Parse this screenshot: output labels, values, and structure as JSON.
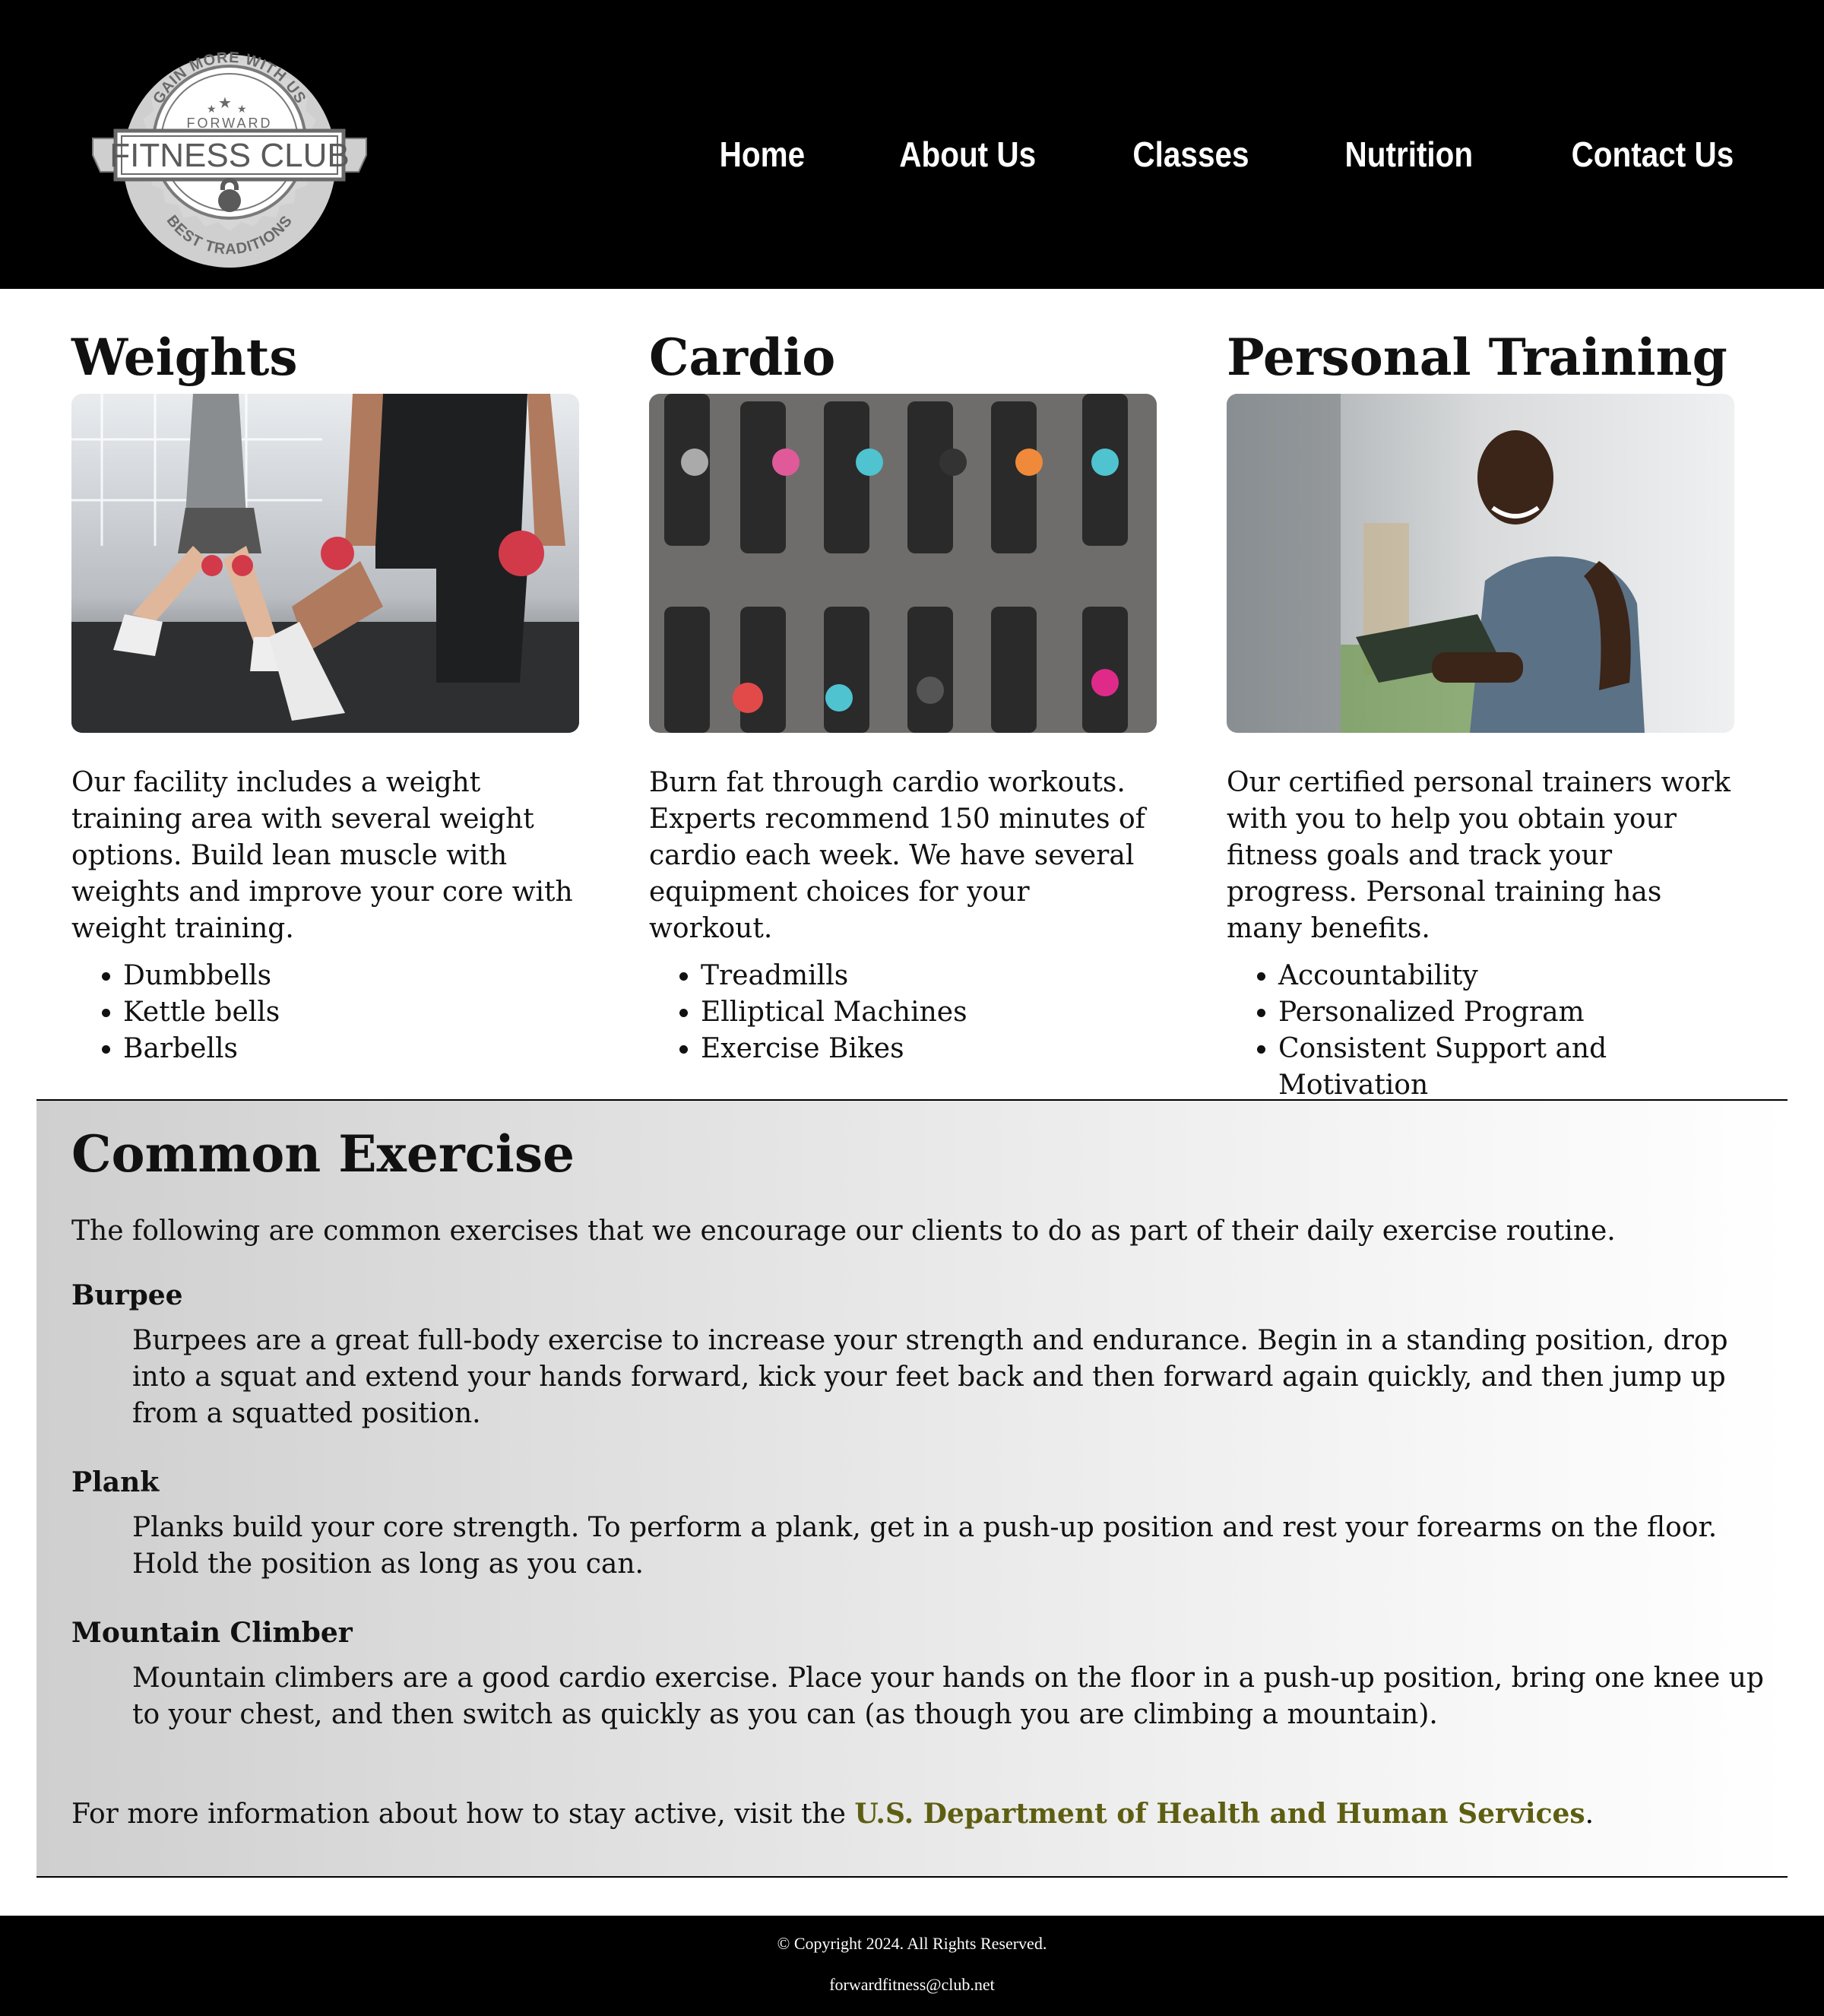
{
  "logo": {
    "arc_top": "GAIN MORE WITH US",
    "small": "FORWARD",
    "banner": "FITNESS CLUB",
    "arc_bottom": "BEST TRADITIONS"
  },
  "nav": [
    "Home",
    "About Us",
    "Classes",
    "Nutrition",
    "Contact Us"
  ],
  "columns": [
    {
      "title": "Weights",
      "image": "photo of two people doing dumbbell lunges",
      "description": "Our facility includes a weight training area with several weight options. Build lean muscle with weights and improve your core with weight training.",
      "items": [
        "Dumbbells",
        "Kettle bells",
        "Barbells"
      ]
    },
    {
      "title": "Cardio",
      "image": "overhead photo of people on exercise bikes",
      "description": "Burn fat through cardio workouts. Experts recommend 150 minutes of cardio each week. We have several equipment choices for your workout.",
      "items": [
        "Treadmills",
        "Elliptical Machines",
        "Exercise Bikes"
      ]
    },
    {
      "title": "Personal Training",
      "image": "photo of smiling trainer holding a clipboard",
      "description": "Our certified personal trainers work with you to help you obtain your fitness goals and track your progress. Personal training has many benefits.",
      "items": [
        "Accountability",
        "Personalized Program",
        "Consistent Support and Motivation"
      ]
    }
  ],
  "common": {
    "title": "Common Exercise",
    "intro": "The following are common exercises that we encourage our clients to do as part of their daily exercise routine.",
    "exercises": [
      {
        "name": "Burpee",
        "description": "Burpees are a great full-body exercise to increase your strength and endurance. Begin in a standing position, drop into a squat and extend your hands forward, kick your feet back and then forward again quickly, and then jump up from a squatted position."
      },
      {
        "name": "Plank",
        "description": "Planks build your core strength. To perform a plank, get in a push-up position and rest your forearms on the floor. Hold the position as long as you can."
      },
      {
        "name": "Mountain Climber",
        "description": "Mountain climbers are a good cardio exercise. Place your hands on the floor in a push-up position, bring one knee up to your chest, and then switch as quickly as you can (as though you are climbing a mountain)."
      }
    ],
    "more_prefix": "For more information about how to stay active, visit the ",
    "more_link": "U.S. Department of Health and Human Services",
    "more_suffix": "."
  },
  "footer": {
    "copyright": "© Copyright 2024. All Rights Reserved.",
    "email": "forwardfitness@club.net"
  },
  "colors": {
    "header_bg": "#000000",
    "link": "#5e5e12",
    "footer_bg": "#000000"
  }
}
